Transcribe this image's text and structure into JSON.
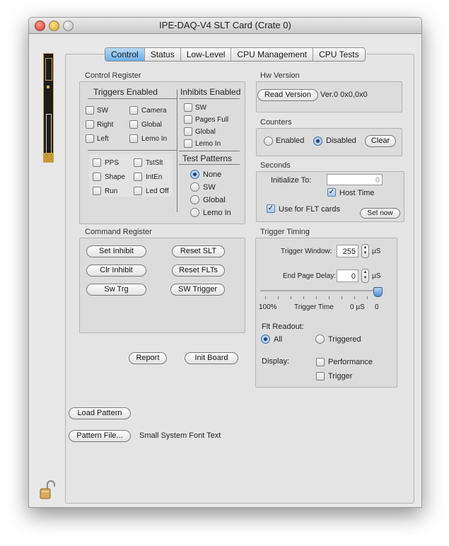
{
  "window": {
    "title": "IPE-DAQ-V4 SLT Card (Crate 0)"
  },
  "tabs": [
    "Control",
    "Status",
    "Low-Level",
    "CPU Management",
    "CPU Tests"
  ],
  "control_register": {
    "title": "Control Register",
    "triggers_header": "Triggers Enabled",
    "inhibits_header": "Inhibits Enabled",
    "triggers": [
      "SW",
      "Camera",
      "Right",
      "Global",
      "Left",
      "Lemo In"
    ],
    "inhibits": [
      "SW",
      "Pages Full",
      "Global",
      "Lemo In"
    ],
    "extra": [
      "PPS",
      "TstSlt",
      "Shape",
      "IntEn",
      "Run",
      "Led Off"
    ],
    "test_patterns_header": "Test Patterns",
    "test_patterns": [
      "None",
      "SW",
      "Global",
      "Lemo In"
    ]
  },
  "hw_version": {
    "title": "Hw Version",
    "button": "Read Version",
    "value": "Ver.0 0x0,0x0"
  },
  "counters": {
    "title": "Counters",
    "enabled": "Enabled",
    "disabled": "Disabled",
    "clear": "Clear"
  },
  "seconds": {
    "title": "Seconds",
    "init_label": "Initialize To:",
    "init_value": "0",
    "host_time": "Host Time",
    "use_flt": "Use for FLT cards",
    "set_now": "Set now"
  },
  "command_register": {
    "title": "Command Register",
    "buttons": [
      "Set Inhibit",
      "Reset SLT",
      "Clr Inhibit",
      "Reset FLTs",
      "Sw Trg",
      "SW Trigger"
    ]
  },
  "trigger_timing": {
    "title": "Trigger Timing",
    "window_label": "Trigger Window:",
    "window_value": "255",
    "window_unit": "µS",
    "end_delay_label": "End Page Delay:",
    "end_delay_value": "0",
    "end_delay_unit": "µS",
    "slider_left": "100%",
    "slider_mid": "Trigger Time",
    "slider_right_unit": "0 µS",
    "slider_right": "0",
    "flt_readout": "Flt Readout:",
    "all": "All",
    "triggered": "Triggered",
    "display": "Display:",
    "performance": "Performance",
    "trigger": "Trigger"
  },
  "bottom": {
    "report": "Report",
    "init_board": "Init Board",
    "load_pattern": "Load Pattern",
    "pattern_file": "Pattern File...",
    "pattern_file_text": "Small System Font Text"
  },
  "colors": {
    "accent": "#6aaee8",
    "window_bg": "#e8e8e8"
  },
  "icons": [
    "close-icon",
    "minimize-icon",
    "zoom-icon",
    "card-image-icon",
    "lock-icon"
  ]
}
